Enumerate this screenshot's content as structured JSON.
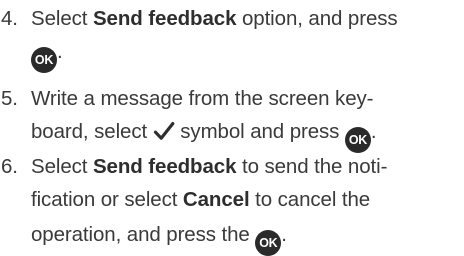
{
  "steps": [
    {
      "number": "4.",
      "line1": {
        "pre": "Select ",
        "bold": "Send feedback",
        "post": " option, and press"
      },
      "line2": {
        "icon": "ok-button-icon",
        "icon_text": "OK",
        "post": "."
      }
    },
    {
      "number": "5.",
      "line1": {
        "text": "Write a message from the screen key-"
      },
      "line2": {
        "pre": "board, select ",
        "icon": "checkmark-icon",
        "mid": " symbol and press ",
        "icon2": "ok-button-icon",
        "icon2_text": "OK",
        "post": "."
      }
    },
    {
      "number": "6.",
      "line1": {
        "pre": "Select ",
        "bold": "Send feedback",
        "post": " to send the noti-"
      },
      "line2": {
        "pre": "fication or select ",
        "bold": "Cancel",
        "post": " to cancel the"
      },
      "line3": {
        "pre": "operation, and press the ",
        "icon": "ok-button-icon",
        "icon_text": "OK",
        "post": "."
      }
    }
  ]
}
